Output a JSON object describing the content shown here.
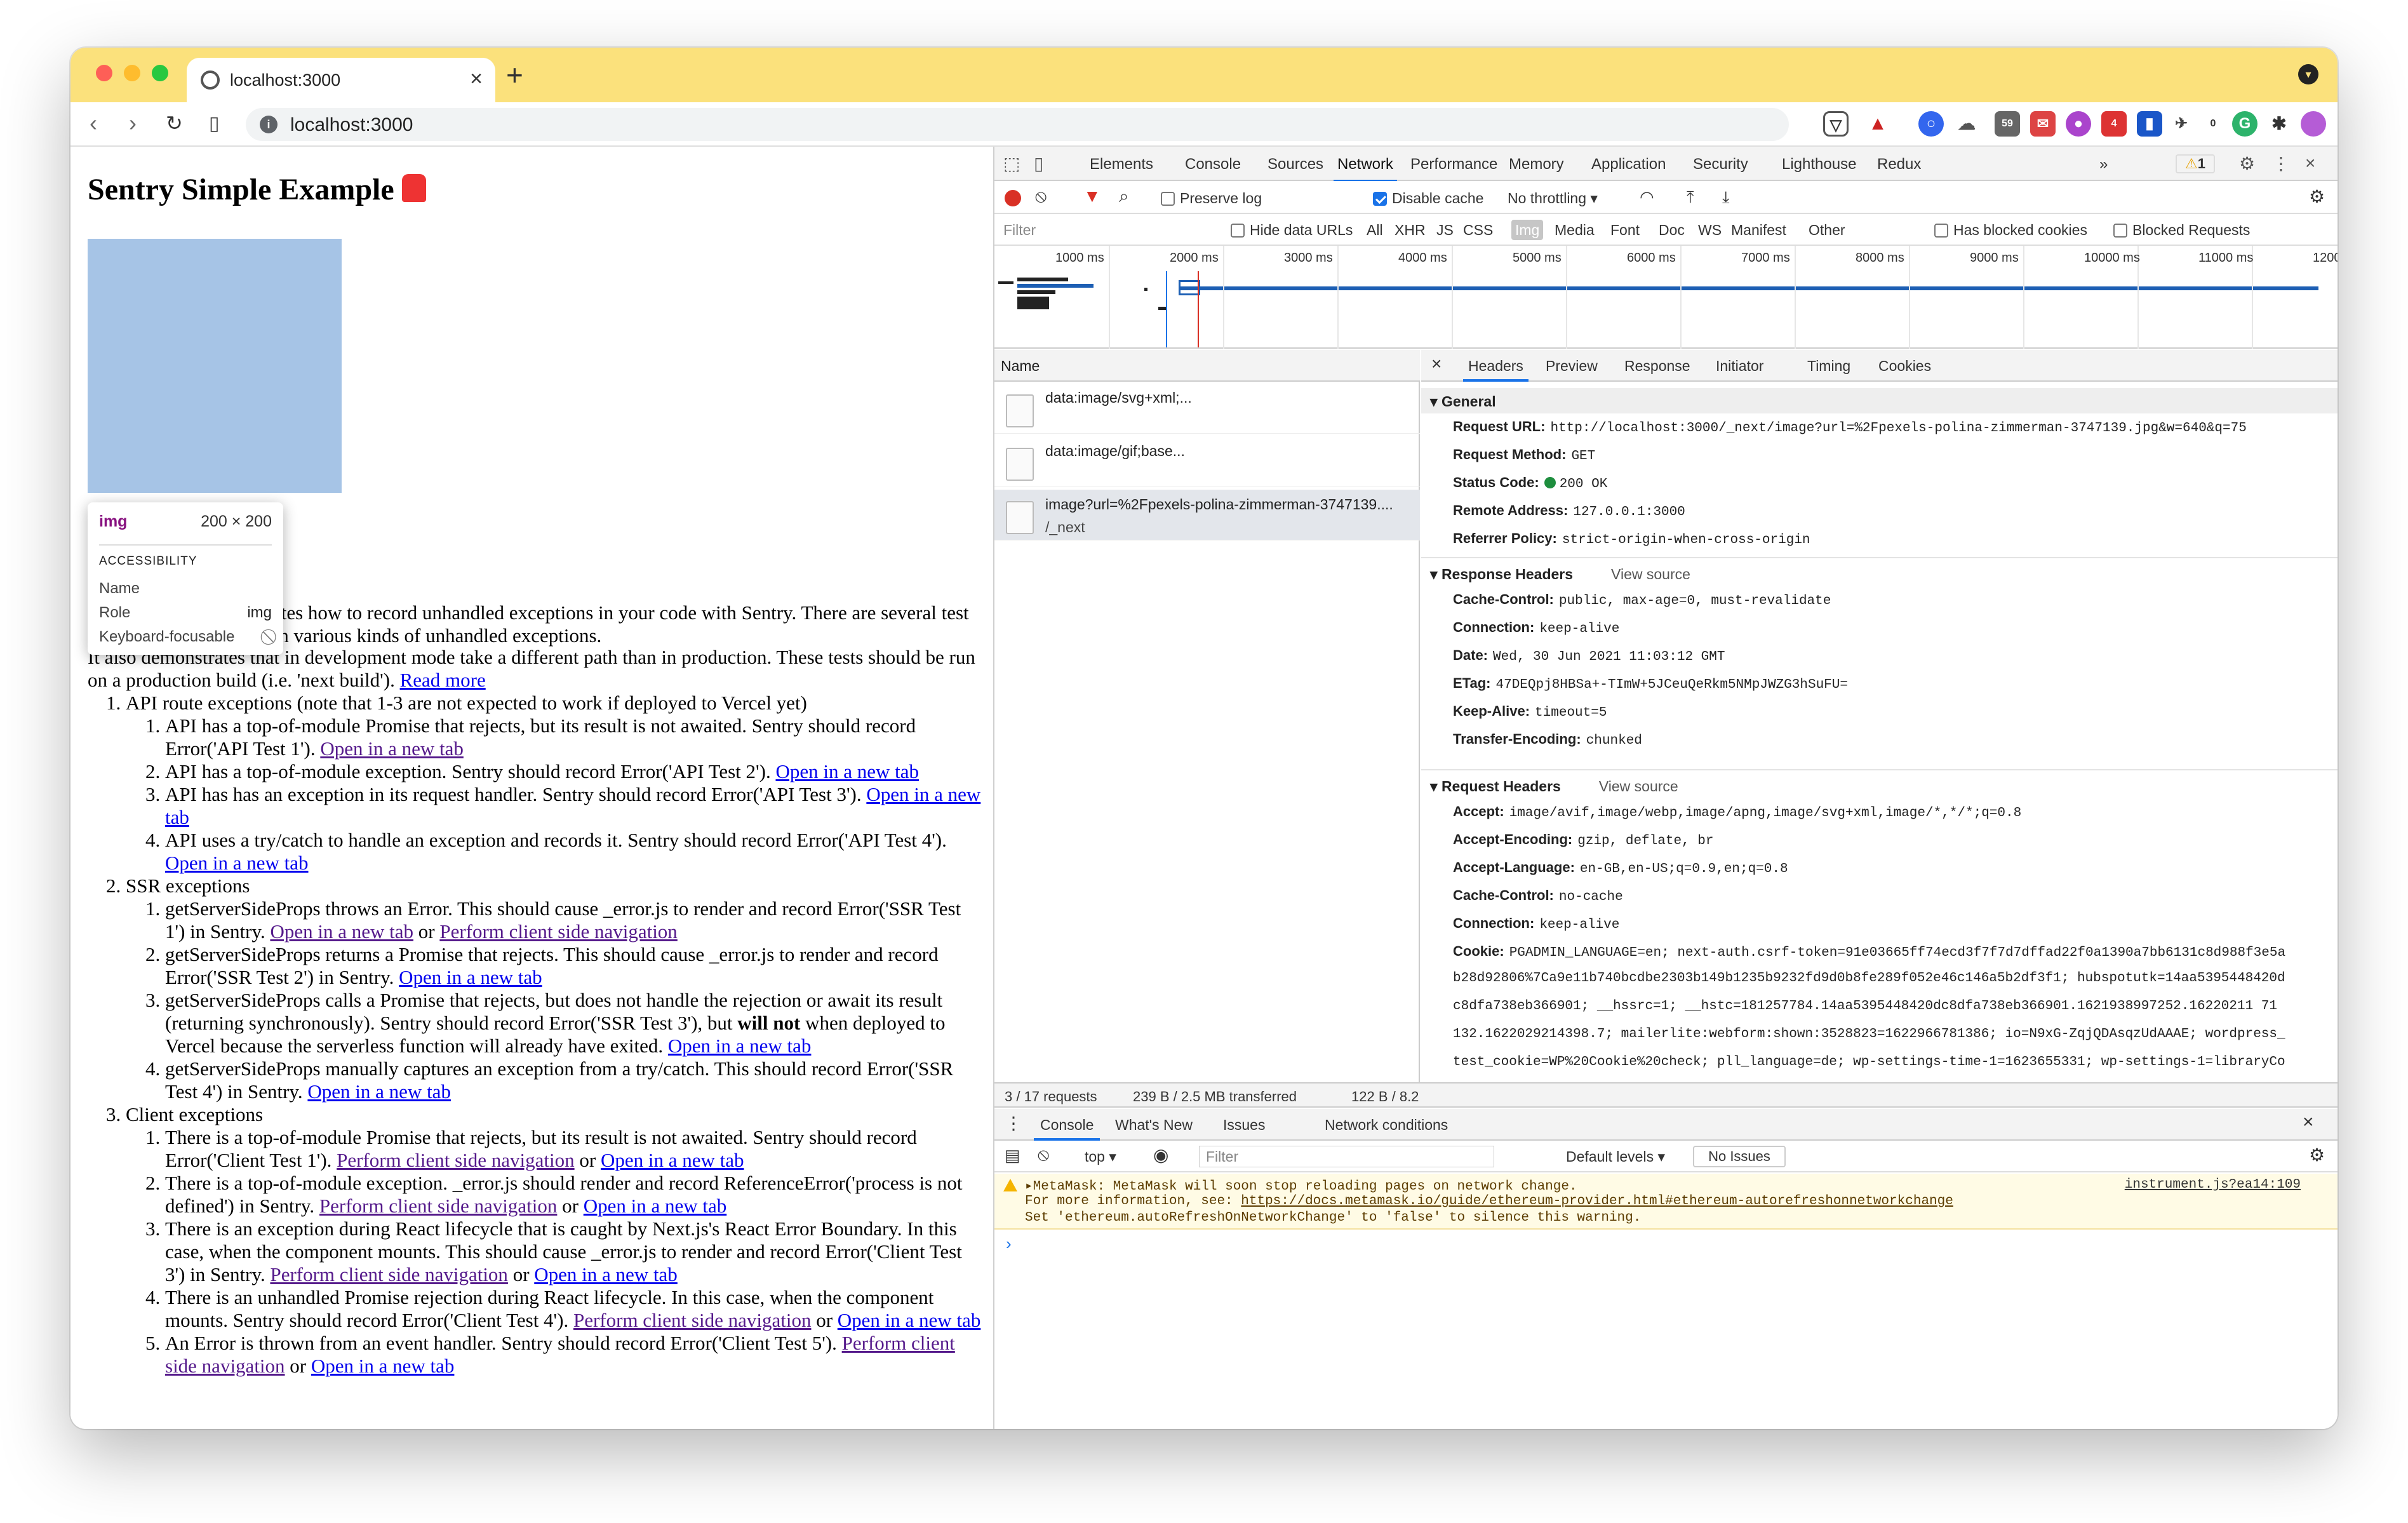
{
  "browser": {
    "tab_title": "localhost:3000",
    "url": "localhost:3000",
    "new_tab": "+",
    "close_tab": "×"
  },
  "page": {
    "title": "Sentry Simple Example",
    "intro_1": "This example demonstrates how to record unhandled exceptions in your code with Sentry. There are several test pages below that result in various kinds of unhandled exceptions.",
    "intro_2a": "It also demonstrates that in development mode take a different path than in production. These tests should be run on a production build (i.e. 'next build').",
    "read_more": "Read more",
    "tooltip": {
      "tag": "img",
      "size": "200 × 200",
      "heading": "ACCESSIBILITY",
      "name_label": "Name",
      "role_label": "Role",
      "role_value": "img",
      "focus_label": "Keyboard-focusable",
      "focus_value": "⃠"
    },
    "sections": [
      {
        "title": "API route exceptions (note that 1-3 are not expected to work if deployed to Vercel yet)",
        "items": [
          {
            "text": "API has a top-of-module Promise that rejects, but its result is not awaited. Sentry should record Error('API Test 1').",
            "links": [
              "Open in a new tab"
            ]
          },
          {
            "text": "API has a top-of-module exception. Sentry should record Error('API Test 2').",
            "links": [
              "Open in a new tab"
            ]
          },
          {
            "text": "API has has an exception in its request handler. Sentry should record Error('API Test 3').",
            "links": [
              "Open in a new tab"
            ]
          },
          {
            "text": "API uses a try/catch to handle an exception and records it. Sentry should record Error('API Test 4').",
            "links": [
              "Open in a new tab"
            ]
          }
        ]
      },
      {
        "title": "SSR exceptions",
        "items": [
          {
            "text": "getServerSideProps throws an Error. This should cause _error.js to render and record Error('SSR Test 1') in Sentry.",
            "links": [
              "Open in a new tab",
              "Perform client side navigation"
            ]
          },
          {
            "text": "getServerSideProps returns a Promise that rejects. This should cause _error.js to render and record Error('SSR Test 2') in Sentry.",
            "links": [
              "Open in a new tab"
            ]
          },
          {
            "text_a": "getServerSideProps calls a Promise that rejects, but does not handle the rejection or await its result (returning synchronously). Sentry should record Error('SSR Test 3'), but",
            "bold": "will not",
            "text_b": "when deployed to Vercel because the serverless function will already have exited.",
            "links": [
              "Open in a new tab"
            ]
          },
          {
            "text": "getServerSideProps manually captures an exception from a try/catch. This should record Error('SSR Test 4') in Sentry.",
            "links": [
              "Open in a new tab"
            ]
          }
        ]
      },
      {
        "title": "Client exceptions",
        "items": [
          {
            "text": "There is a top-of-module Promise that rejects, but its result is not awaited. Sentry should record Error('Client Test 1').",
            "links": [
              "Perform client side navigation",
              "Open in a new tab"
            ]
          },
          {
            "text": "There is a top-of-module exception. _error.js should render and record ReferenceError('process is not defined') in Sentry.",
            "links": [
              "Perform client side navigation",
              "Open in a new tab"
            ]
          },
          {
            "text": "There is an exception during React lifecycle that is caught by Next.js's React Error Boundary. In this case, when the component mounts. This should cause _error.js to render and record Error('Client Test 3') in Sentry.",
            "links": [
              "Perform client side navigation",
              "Open in a new tab"
            ]
          },
          {
            "text": "There is an unhandled Promise rejection during React lifecycle. In this case, when the component mounts. Sentry should record Error('Client Test 4').",
            "links": [
              "Perform client side navigation",
              "Open in a new tab"
            ]
          },
          {
            "text": "An Error is thrown from an event handler. Sentry should record Error('Client Test 5').",
            "links": [
              "Perform client side navigation",
              "Open in a new tab"
            ]
          }
        ]
      }
    ],
    "or": "or"
  },
  "devtools": {
    "tabs": [
      "Elements",
      "Console",
      "Sources",
      "Network",
      "Performance",
      "Memory",
      "Application",
      "Security",
      "Lighthouse",
      "Redux"
    ],
    "active_tab": "Network",
    "more": "»",
    "warn_count": "1",
    "network_toolbar": {
      "preserve_log": "Preserve log",
      "disable_cache": "Disable cache",
      "throttling": "No throttling"
    },
    "filter": {
      "placeholder": "Filter",
      "hide_data_urls": "Hide data URLs",
      "types": [
        "All",
        "XHR",
        "JS",
        "CSS",
        "Img",
        "Media",
        "Font",
        "Doc",
        "WS",
        "Manifest",
        "Other"
      ],
      "selected_type": "Img",
      "has_blocked_cookies": "Has blocked cookies",
      "blocked_requests": "Blocked Requests"
    },
    "timeline_ticks": [
      "1000 ms",
      "2000 ms",
      "3000 ms",
      "4000 ms",
      "5000 ms",
      "6000 ms",
      "7000 ms",
      "8000 ms",
      "9000 ms",
      "10000 ms",
      "11000 ms",
      "1200"
    ],
    "requests": {
      "column": "Name",
      "rows": [
        {
          "name": "data:image/svg+xml;...",
          "sub": ""
        },
        {
          "name": "data:image/gif;base...",
          "sub": ""
        },
        {
          "name": "image?url=%2Fpexels-polina-zimmerman-3747139....",
          "sub": "/_next"
        }
      ]
    },
    "status": {
      "requests": "3 / 17 requests",
      "transferred": "239 B / 2.5 MB transferred",
      "resources": "122 B / 8.2"
    },
    "detail_tabs": [
      "Headers",
      "Preview",
      "Response",
      "Initiator",
      "Timing",
      "Cookies"
    ],
    "detail_active": "Headers",
    "general": {
      "title": "General",
      "request_url_k": "Request URL:",
      "request_url_v": "http://localhost:3000/_next/image?url=%2Fpexels-polina-zimmerman-3747139.jpg&w=640&q=75",
      "method_k": "Request Method:",
      "method_v": "GET",
      "status_k": "Status Code:",
      "status_v": "200 OK",
      "remote_k": "Remote Address:",
      "remote_v": "127.0.0.1:3000",
      "referrer_k": "Referrer Policy:",
      "referrer_v": "strict-origin-when-cross-origin"
    },
    "response_headers": {
      "title": "Response Headers",
      "view_source": "View source",
      "rows": [
        {
          "k": "Cache-Control:",
          "v": "public, max-age=0, must-revalidate"
        },
        {
          "k": "Connection:",
          "v": "keep-alive"
        },
        {
          "k": "Date:",
          "v": "Wed, 30 Jun 2021 11:03:12 GMT"
        },
        {
          "k": "ETag:",
          "v": "47DEQpj8HBSa+-TImW+5JCeuQeRkm5NMpJWZG3hSuFU="
        },
        {
          "k": "Keep-Alive:",
          "v": "timeout=5"
        },
        {
          "k": "Transfer-Encoding:",
          "v": "chunked"
        }
      ]
    },
    "request_headers": {
      "title": "Request Headers",
      "view_source": "View source",
      "rows": [
        {
          "k": "Accept:",
          "v": "image/avif,image/webp,image/apng,image/svg+xml,image/*,*/*;q=0.8"
        },
        {
          "k": "Accept-Encoding:",
          "v": "gzip, deflate, br"
        },
        {
          "k": "Accept-Language:",
          "v": "en-GB,en-US;q=0.9,en;q=0.8"
        },
        {
          "k": "Cache-Control:",
          "v": "no-cache"
        },
        {
          "k": "Connection:",
          "v": "keep-alive"
        },
        {
          "k": "Cookie:",
          "v": "PGADMIN_LANGUAGE=en; next-auth.csrf-token=91e03665ff74ecd3f7f7d7dffad22f0a1390a7bb6131c8d988f3e5a"
        }
      ],
      "cookie_cont": [
        "b28d92806%7Ca9e11b740bcdbe2303b149b1235b9232fd9d0b8fe289f052e46c146a5b2df3f1; hubspotutk=14aa5395448420d",
        "c8dfa738eb366901; __hssrc=1; __hstc=181257784.14aa5395448420dc8dfa738eb366901.1621938997252.16220211 71",
        "132.1622029214398.7; mailerlite:webform:shown:3528823=1622966781386; io=N9xG-ZqjQDAsqzUdAAAE; wordpress_",
        "test_cookie=WP%20Cookie%20check; pll_language=de; wp-settings-time-1=1623655331; wp-settings-1=libraryCo"
      ]
    },
    "drawer": {
      "tabs": [
        "Console",
        "What's New",
        "Issues",
        "Network conditions"
      ],
      "active": "Console",
      "context": "top",
      "filter_placeholder": "Filter",
      "levels": "Default levels",
      "no_issues": "No Issues"
    },
    "console_warning": {
      "line1": "▸MetaMask: MetaMask will soon stop reloading pages on network change.",
      "line2_prefix": "For more information, see: ",
      "line2_link": "https://docs.metamask.io/guide/ethereum-provider.html#ethereum-autorefreshonnetworkchange",
      "line3": "Set 'ethereum.autoRefreshOnNetworkChange' to 'false' to silence this warning.",
      "source": "instrument.js?ea14:109"
    },
    "prompt": "›"
  },
  "colors": {
    "tabbar": "#fbe17c",
    "image_placeholder": "#a6c4e6",
    "accent": "#1a73e8"
  }
}
